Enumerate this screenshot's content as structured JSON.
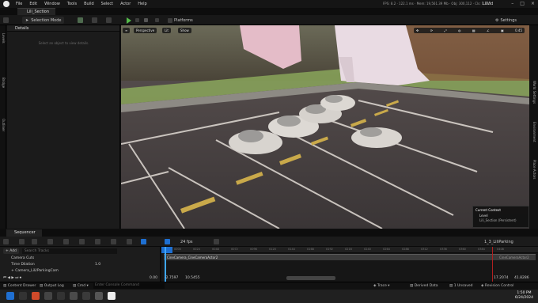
{
  "menubar": {
    "items": [
      "File",
      "Edit",
      "Window",
      "Tools",
      "Build",
      "Select",
      "Actor",
      "Help"
    ],
    "stats": "FPS: 8.2  ·  122.1 ms  ·  Mem: 19,561.39 Mb  ·  Obj: 300,112  ·  Cls: 1,321",
    "project": "LilVid"
  },
  "level_tab": "Lili_Section",
  "toolbar": {
    "selection_mode": "Selection Mode",
    "platforms": "Platforms",
    "settings": "Settings"
  },
  "left_strip": [
    "Levels",
    "Bridge",
    "Outliner"
  ],
  "details": {
    "title": "Details",
    "hint": "Select an object to view details."
  },
  "viewport": {
    "perspective": "Perspective",
    "lit": "Lit",
    "show": "Show",
    "camera_speed": "0.45"
  },
  "right_strip": [
    "World Settings",
    "Environment",
    "Place Actors"
  ],
  "current_context": {
    "title": "Current Context",
    "level_label": "Level",
    "level_value": "Lili_Section (Persistent)"
  },
  "sequencer": {
    "tab": "Sequencer",
    "add_label": "+ Add",
    "search_placeholder": "Search Tracks",
    "fps": "24 fps",
    "sequence_name": "1_3_LiliParking",
    "tracks": [
      "Camera Cuts",
      "Time Dilation",
      "+ Camera_Lili/ParkingCam"
    ],
    "time_dilation_value": "1.0",
    "section_label": "CineCamera_CineCameraActor2",
    "section_end_label": "CineCameraActor2",
    "time_current": "0.00",
    "time_start": "-2.7597",
    "time_end": "10.5455",
    "right_time_a": "17.2074",
    "right_time_b": "41.8286",
    "ticks": [
      "0000",
      "0024",
      "0048",
      "0072",
      "0096",
      "0120",
      "0144",
      "0168",
      "0192",
      "0216",
      "0240",
      "0264",
      "0288",
      "0312",
      "0336",
      "0360",
      "0384",
      "0408"
    ]
  },
  "statusbar": {
    "content_drawer": "Content Drawer",
    "output_log": "Output Log",
    "cmd": "Cmd",
    "console_placeholder": "Enter Console Command",
    "trace": "Trace",
    "derived_data": "Derived Data",
    "unsaved": "1 Unsaved",
    "revision_control": "Revision Control"
  },
  "taskbar": {
    "time": "1:50 PM",
    "date": "6/24/2024"
  },
  "colors": {
    "accent": "#1e6fd1",
    "play": "#54b94a",
    "playhead": "#3fa7ff"
  }
}
